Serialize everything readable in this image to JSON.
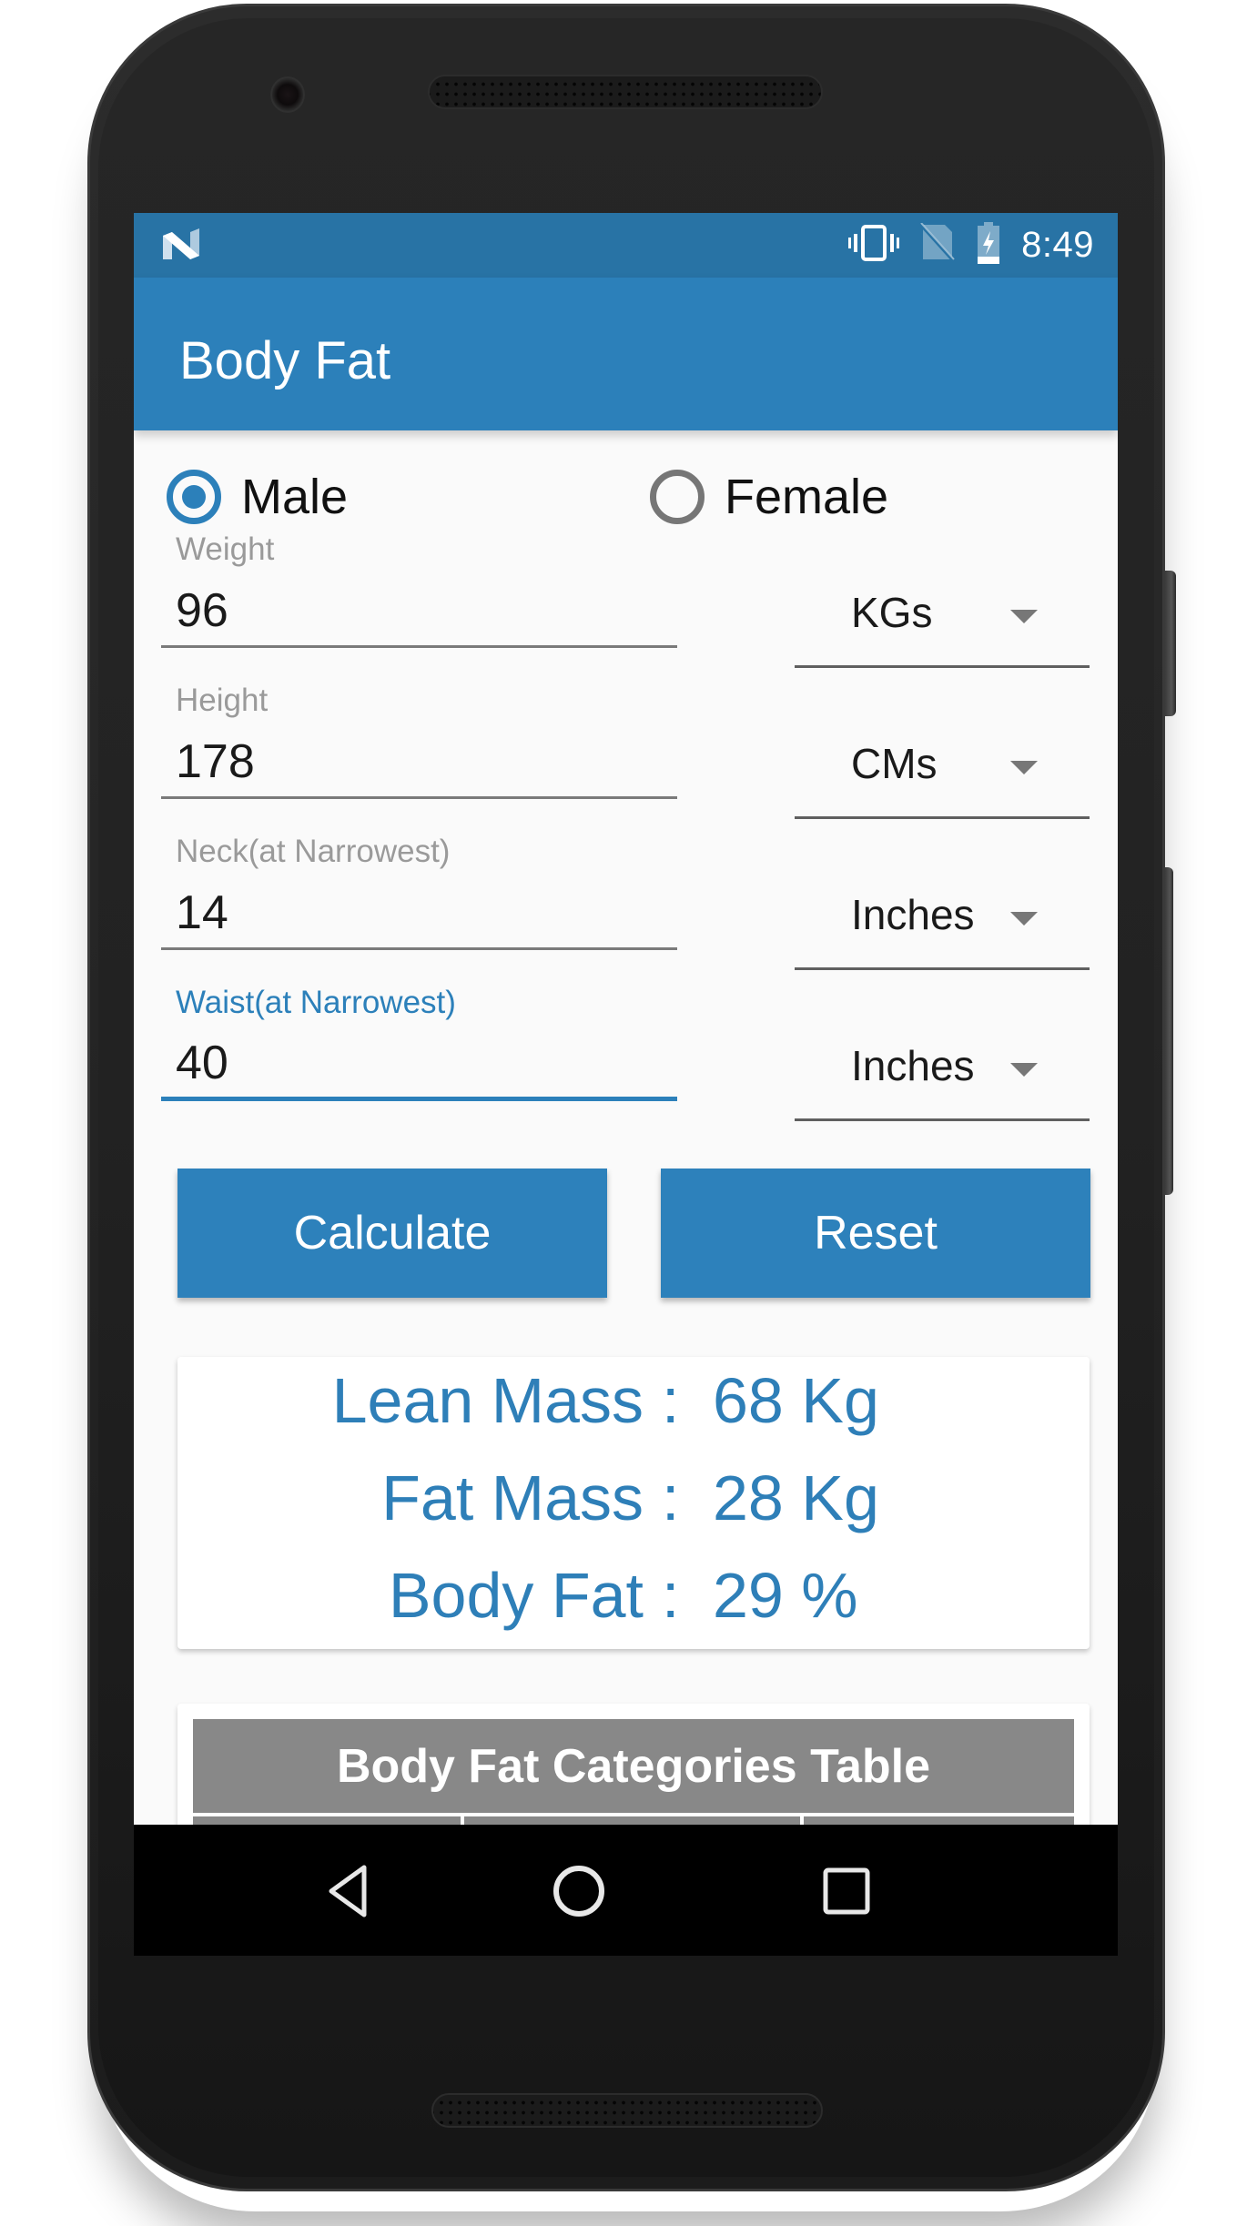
{
  "status_bar": {
    "notification_icon": "android-n-icon",
    "icons": [
      "vibrate-icon",
      "no-sim-icon",
      "battery-charging-icon"
    ],
    "time": "8:49"
  },
  "app_bar": {
    "title": "Body Fat"
  },
  "gender": {
    "options": [
      {
        "label": "Male",
        "checked": true
      },
      {
        "label": "Female",
        "checked": false
      }
    ]
  },
  "fields": [
    {
      "label": "Weight",
      "value": "96",
      "unit": "KGs",
      "focused": false
    },
    {
      "label": "Height",
      "value": "178",
      "unit": "CMs",
      "focused": false
    },
    {
      "label": "Neck(at Narrowest)",
      "value": "14",
      "unit": "Inches",
      "focused": false
    },
    {
      "label": "Waist(at Narrowest)",
      "value": "40",
      "unit": "Inches",
      "focused": true
    }
  ],
  "buttons": {
    "calculate": "Calculate",
    "reset": "Reset"
  },
  "results": [
    {
      "label": "Lean Mass",
      "separator": ":",
      "value": "68 Kg"
    },
    {
      "label": "Fat Mass",
      "separator": ":",
      "value": "28 Kg"
    },
    {
      "label": "Body Fat",
      "separator": ":",
      "value": "29 %"
    }
  ],
  "categories_table": {
    "title": "Body Fat Categories Table"
  },
  "nav_bar": {
    "buttons": [
      "back-icon",
      "home-icon",
      "recents-icon"
    ]
  },
  "colors": {
    "primary": "#2c80ba",
    "primary_dark": "#2873a5",
    "result_text": "#2e7fb8",
    "table_header": "#888888"
  }
}
